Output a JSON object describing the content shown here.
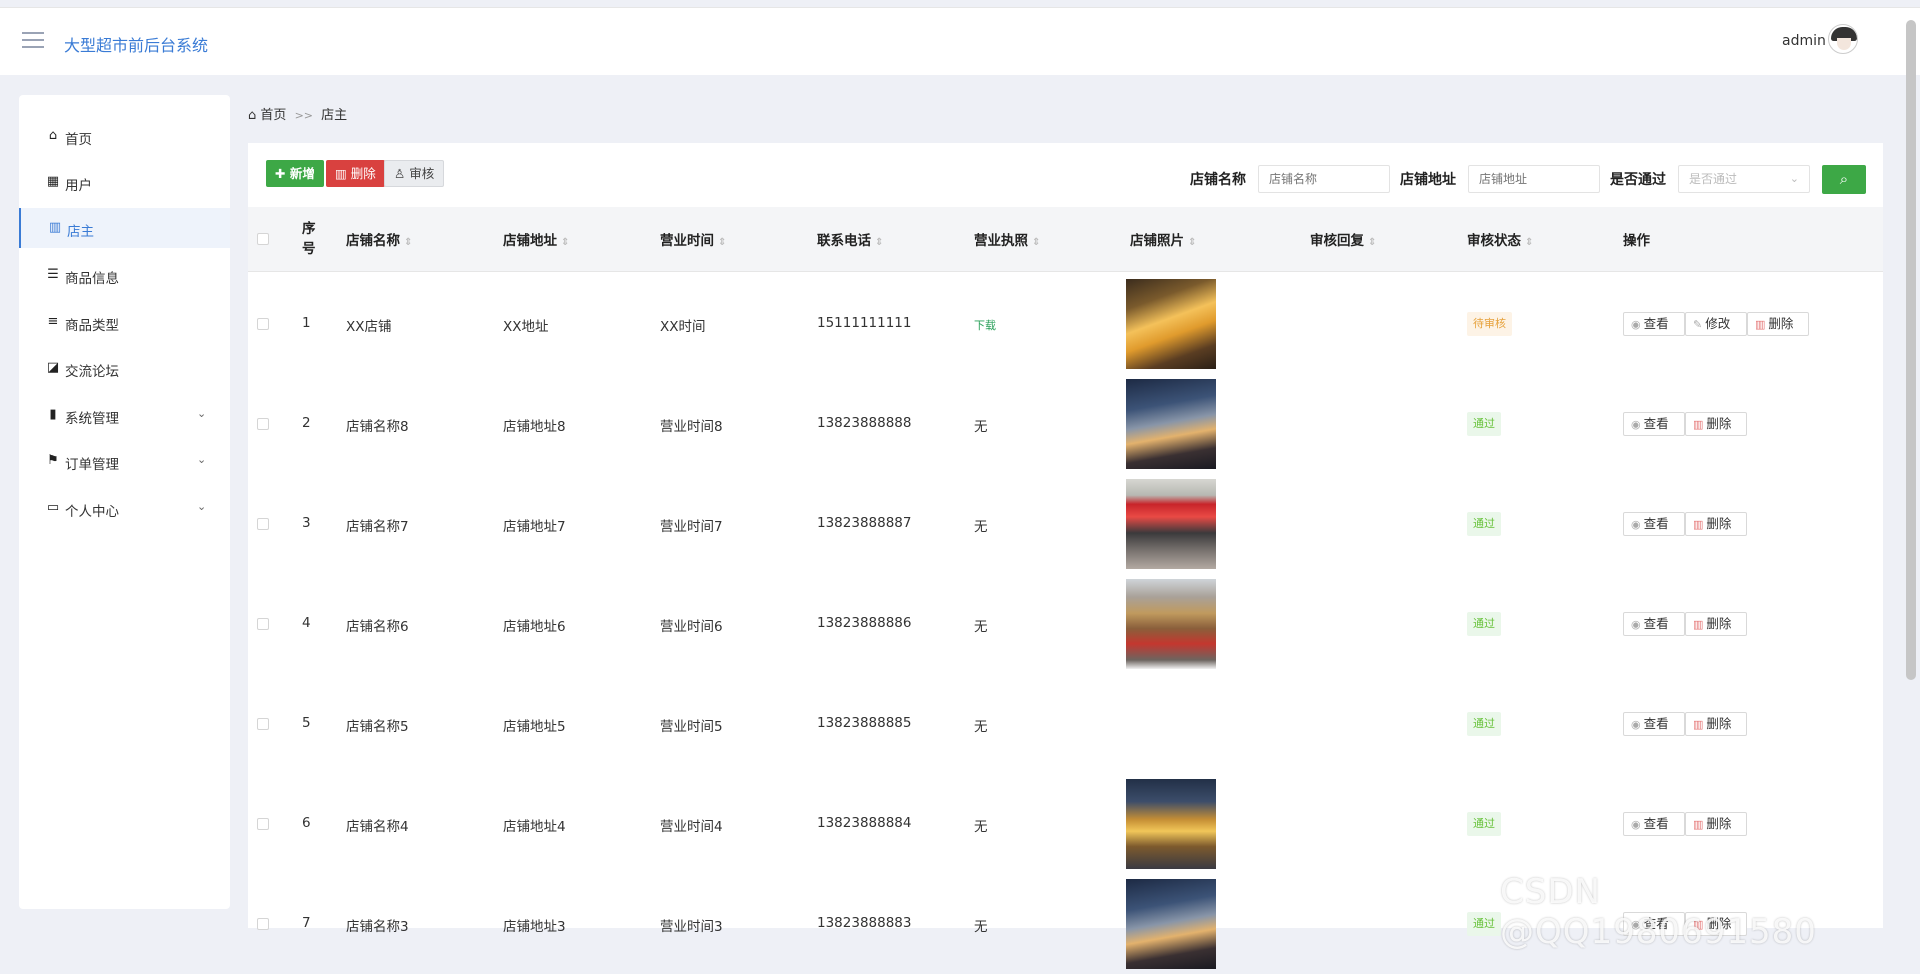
{
  "header": {
    "title": "大型超市前后台系统",
    "user": "admin"
  },
  "sidebar": {
    "items": [
      {
        "label": "首页",
        "icon": "home-icon"
      },
      {
        "label": "用户",
        "icon": "grid-icon"
      },
      {
        "label": "店主",
        "icon": "books-icon",
        "active": true
      },
      {
        "label": "商品信息",
        "icon": "sliders-icon"
      },
      {
        "label": "商品类型",
        "icon": "list-icon"
      },
      {
        "label": "交流论坛",
        "icon": "trend-chart-icon"
      },
      {
        "label": "系统管理",
        "icon": "bar-chart-icon",
        "expandable": true
      },
      {
        "label": "订单管理",
        "icon": "flag-icon",
        "expandable": true
      },
      {
        "label": "个人中心",
        "icon": "card-icon",
        "expandable": true
      }
    ]
  },
  "breadcrumb": {
    "home": "首页",
    "sep": ">>",
    "current": "店主"
  },
  "toolbar": {
    "add": "新增",
    "delete": "删除",
    "audit": "审核"
  },
  "filters": {
    "name_label": "店铺名称",
    "name_placeholder": "店铺名称",
    "addr_label": "店铺地址",
    "addr_placeholder": "店铺地址",
    "pass_label": "是否通过",
    "pass_placeholder": "是否通过"
  },
  "table": {
    "columns": [
      "序号",
      "店铺名称",
      "店铺地址",
      "营业时间",
      "联系电话",
      "营业执照",
      "店铺照片",
      "审核回复",
      "审核状态",
      "操作"
    ],
    "rows": [
      {
        "no": "1",
        "name": "XX店铺",
        "addr": "XX地址",
        "hours": "XX时间",
        "phone": "15111111111",
        "license": "下载",
        "status": "待审核",
        "status_type": "wait",
        "actions": [
          "查看",
          "修改",
          "删除"
        ],
        "photo": "yellow"
      },
      {
        "no": "2",
        "name": "店铺名称8",
        "addr": "店铺地址8",
        "hours": "营业时间8",
        "phone": "13823888888",
        "license": "无",
        "status": "通过",
        "status_type": "ok",
        "actions": [
          "查看",
          "删除"
        ],
        "photo": "night"
      },
      {
        "no": "3",
        "name": "店铺名称7",
        "addr": "店铺地址7",
        "hours": "营业时间7",
        "phone": "13823888887",
        "license": "无",
        "status": "通过",
        "status_type": "ok",
        "actions": [
          "查看",
          "删除"
        ],
        "photo": "red"
      },
      {
        "no": "4",
        "name": "店铺名称6",
        "addr": "店铺地址6",
        "hours": "营业时间6",
        "phone": "13823888886",
        "license": "无",
        "status": "通过",
        "status_type": "ok",
        "actions": [
          "查看",
          "删除"
        ],
        "photo": "street"
      },
      {
        "no": "5",
        "name": "店铺名称5",
        "addr": "店铺地址5",
        "hours": "营业时间5",
        "phone": "13823888885",
        "license": "无",
        "status": "通过",
        "status_type": "ok",
        "actions": [
          "查看",
          "删除"
        ],
        "photo": ""
      },
      {
        "no": "6",
        "name": "店铺名称4",
        "addr": "店铺地址4",
        "hours": "营业时间4",
        "phone": "13823888884",
        "license": "无",
        "status": "通过",
        "status_type": "ok",
        "actions": [
          "查看",
          "删除"
        ],
        "photo": "gold"
      },
      {
        "no": "7",
        "name": "店铺名称3",
        "addr": "店铺地址3",
        "hours": "营业时间3",
        "phone": "13823888883",
        "license": "无",
        "status": "通过",
        "status_type": "ok",
        "actions": [
          "查看",
          "删除"
        ],
        "photo": "night"
      }
    ]
  },
  "watermark": "CSDN @QQ1980691580",
  "colors": {
    "accent": "#3a7bd5",
    "success": "#3da846",
    "danger": "#d9413f",
    "warning": "#e6a23c"
  }
}
